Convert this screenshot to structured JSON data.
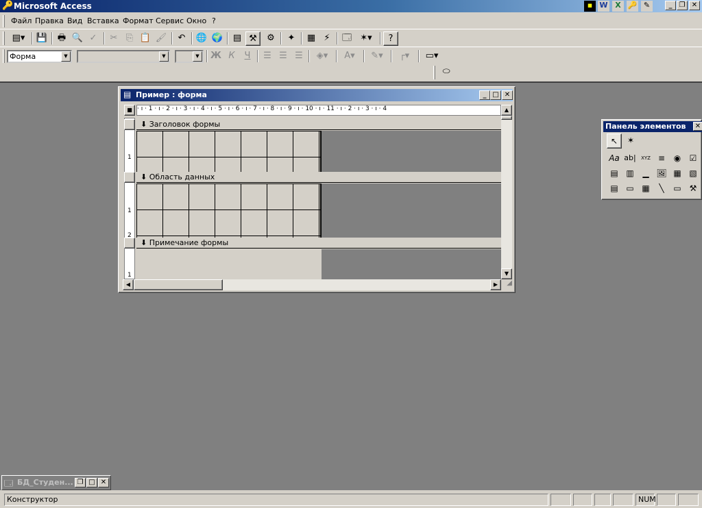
{
  "app": {
    "title": "Microsoft Access"
  },
  "menu": [
    "Файл",
    "Правка",
    "Вид",
    "Вставка",
    "Формат",
    "Сервис",
    "Окно",
    "?"
  ],
  "formatting": {
    "object_combo": "Форма",
    "font_combo": "",
    "size_combo": ""
  },
  "form_window": {
    "title": "Пример : форма",
    "ruler_h": "· ı · 1 · ı · 2 · ı · 3 · ı · 4 · ı · 5 · ı · 6 · ı · 7 · ı · 8 · ı · 9 · ı · 10 · ı · 11 · ı · 2 · ı · 3 · ı · 4",
    "sections": [
      "Заголовок формы",
      "Область данных",
      "Примечание формы"
    ],
    "ruler_v_marks": [
      "1",
      "1",
      "2",
      "1"
    ]
  },
  "toolbox": {
    "title": "Панель элементов",
    "tools": [
      "Aa",
      "ab|",
      "XYZ",
      "≡",
      "◉",
      "☑",
      "▤",
      "▥",
      "▁",
      "🖼",
      "▦",
      "▧",
      "▤",
      "▭",
      "▦",
      "╲",
      "▭",
      "⚒"
    ]
  },
  "minimized": {
    "title": "БД_Студен..."
  },
  "status": {
    "mode": "Конструктор",
    "num": "NUM"
  }
}
